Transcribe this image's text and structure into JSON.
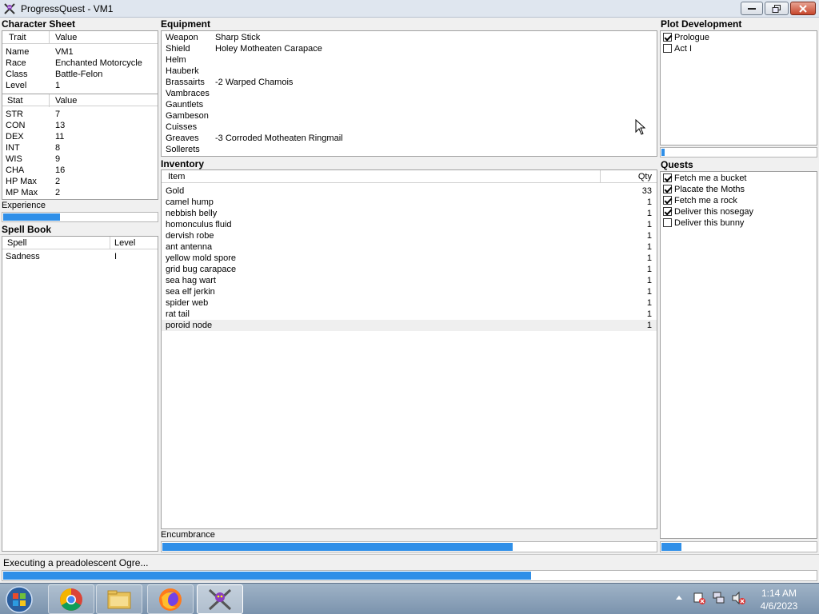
{
  "window": {
    "title": "ProgressQuest - VM1"
  },
  "character_sheet": {
    "title": "Character Sheet",
    "col_trait": "Trait",
    "col_value": "Value",
    "traits": [
      {
        "label": "Name",
        "value": "VM1"
      },
      {
        "label": "Race",
        "value": "Enchanted Motorcycle"
      },
      {
        "label": "Class",
        "value": "Battle-Felon"
      },
      {
        "label": "Level",
        "value": "1"
      }
    ],
    "col_stat": "Stat",
    "col_stat_value": "Value",
    "stats": [
      {
        "label": "STR",
        "value": "7"
      },
      {
        "label": "CON",
        "value": "13"
      },
      {
        "label": "DEX",
        "value": "11"
      },
      {
        "label": "INT",
        "value": "8"
      },
      {
        "label": "WIS",
        "value": "9"
      },
      {
        "label": "CHA",
        "value": "16"
      },
      {
        "label": "HP Max",
        "value": "2"
      },
      {
        "label": "MP Max",
        "value": "2"
      }
    ],
    "experience_label": "Experience",
    "experience_progress": 0.37
  },
  "spell_book": {
    "title": "Spell Book",
    "col_spell": "Spell",
    "col_level": "Level",
    "spells": [
      {
        "name": "Sadness",
        "level": "I"
      }
    ]
  },
  "equipment": {
    "title": "Equipment",
    "items": [
      {
        "slot": "Weapon",
        "item": "Sharp Stick"
      },
      {
        "slot": "Shield",
        "item": "Holey Motheaten Carapace"
      },
      {
        "slot": "Helm",
        "item": ""
      },
      {
        "slot": "Hauberk",
        "item": ""
      },
      {
        "slot": "Brassairts",
        "item": "-2 Warped Chamois"
      },
      {
        "slot": "Vambraces",
        "item": ""
      },
      {
        "slot": "Gauntlets",
        "item": ""
      },
      {
        "slot": "Gambeson",
        "item": ""
      },
      {
        "slot": "Cuisses",
        "item": ""
      },
      {
        "slot": "Greaves",
        "item": "-3 Corroded Motheaten Ringmail"
      },
      {
        "slot": "Sollerets",
        "item": ""
      }
    ]
  },
  "inventory": {
    "title": "Inventory",
    "col_item": "Item",
    "col_qty": "Qty",
    "items": [
      {
        "name": "Gold",
        "qty": "33"
      },
      {
        "name": "camel hump",
        "qty": "1"
      },
      {
        "name": "nebbish belly",
        "qty": "1"
      },
      {
        "name": "homonculus fluid",
        "qty": "1"
      },
      {
        "name": "dervish robe",
        "qty": "1"
      },
      {
        "name": "ant antenna",
        "qty": "1"
      },
      {
        "name": "yellow mold spore",
        "qty": "1"
      },
      {
        "name": "grid bug carapace",
        "qty": "1"
      },
      {
        "name": "sea hag wart",
        "qty": "1"
      },
      {
        "name": "sea elf jerkin",
        "qty": "1"
      },
      {
        "name": "spider web",
        "qty": "1"
      },
      {
        "name": "rat tail",
        "qty": "1"
      },
      {
        "name": "poroid node",
        "qty": "1"
      }
    ],
    "encumbrance_label": "Encumbrance",
    "encumbrance_progress": 0.71
  },
  "plot": {
    "title": "Plot Development",
    "acts": [
      {
        "label": "Prologue",
        "checked": true
      },
      {
        "label": "Act I",
        "checked": false
      }
    ],
    "progress": 0.02
  },
  "quests": {
    "title": "Quests",
    "items": [
      {
        "label": "Fetch me a bucket",
        "checked": true
      },
      {
        "label": "Placate the Moths",
        "checked": true
      },
      {
        "label": "Fetch me a rock",
        "checked": true
      },
      {
        "label": "Deliver this nosegay",
        "checked": true
      },
      {
        "label": "Deliver this bunny",
        "checked": false
      }
    ],
    "progress": 0.13
  },
  "status": {
    "text": "Executing a preadolescent Ogre...",
    "progress": 0.65
  },
  "taskbar": {
    "apps": [
      "start-icon",
      "chrome-icon",
      "file-explorer-icon",
      "firefox-icon",
      "progressquest-icon"
    ],
    "clock_time": "1:14 AM",
    "clock_date": "4/6/2023"
  },
  "colors": {
    "progress_fill": "#2f8fe8",
    "selected_row": "#efefef"
  }
}
